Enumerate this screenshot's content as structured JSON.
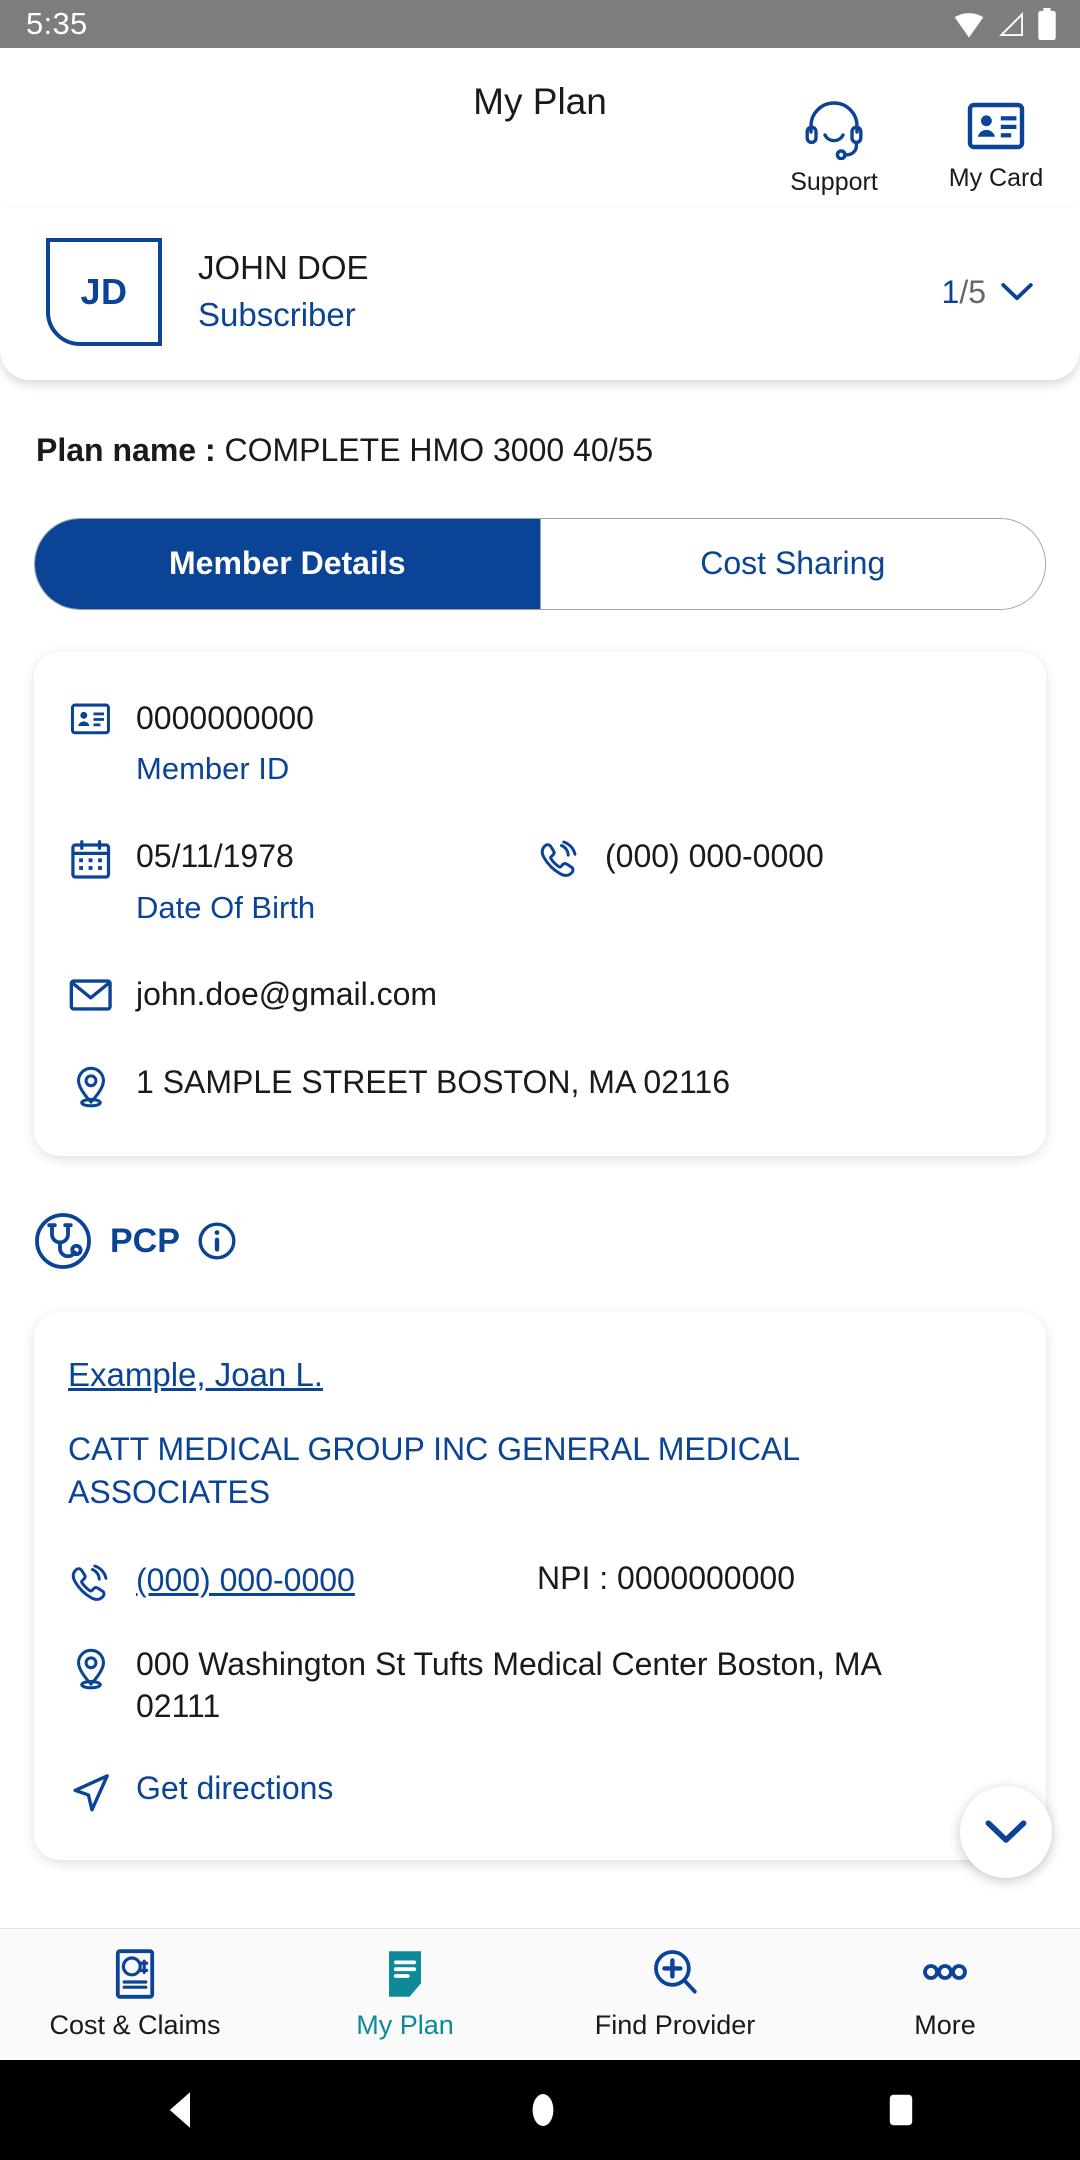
{
  "statusbar": {
    "time": "5:35"
  },
  "appbar": {
    "title": "My Plan",
    "actions": [
      {
        "label": "Support",
        "icon": "headset-icon"
      },
      {
        "label": "My Card",
        "icon": "id-card-icon"
      }
    ]
  },
  "member_header": {
    "initials": "JD",
    "name": "JOHN DOE",
    "role": "Subscriber",
    "pager_current": "1",
    "pager_rest": "/5"
  },
  "plan": {
    "label": "Plan name :",
    "value": "COMPLETE HMO 3000 40/55"
  },
  "tabs": [
    {
      "label": "Member Details",
      "active": true
    },
    {
      "label": "Cost Sharing",
      "active": false
    }
  ],
  "member_details": {
    "member_id": {
      "value": "0000000000",
      "label": "Member ID",
      "icon": "id-card-icon"
    },
    "dob": {
      "value": "05/11/1978",
      "label": "Date Of Birth",
      "icon": "calendar-icon"
    },
    "phone": {
      "value": "(000) 000-0000",
      "icon": "phone-icon"
    },
    "email": {
      "value": "john.doe@gmail.com",
      "icon": "mail-icon"
    },
    "address": {
      "value": "1 SAMPLE STREET BOSTON, MA 02116",
      "icon": "location-pin-icon"
    }
  },
  "pcp_section": {
    "title": "PCP",
    "icon": "stethoscope-icon",
    "info_icon": "info-icon"
  },
  "pcp": {
    "provider_name": "Example, Joan L.",
    "organization": "CATT MEDICAL GROUP INC GENERAL MEDICAL ASSOCIATES",
    "phone": "(000) 000-0000",
    "npi_label": "NPI :",
    "npi_value": "0000000000",
    "address": "000 Washington St Tufts Medical Center Boston, MA 02111",
    "directions_label": "Get directions",
    "expand_icon": "chevron-down-icon"
  },
  "bottom_nav": [
    {
      "label": "Cost & Claims",
      "icon": "receipt-dollar-icon",
      "active": false
    },
    {
      "label": "My Plan",
      "icon": "document-icon",
      "active": true
    },
    {
      "label": "Find Provider",
      "icon": "search-plus-icon",
      "active": false
    },
    {
      "label": "More",
      "icon": "ellipsis-icon",
      "active": false
    }
  ],
  "android_nav": [
    {
      "icon": "back-icon"
    },
    {
      "icon": "home-icon"
    },
    {
      "icon": "recents-icon"
    }
  ],
  "colors": {
    "primary": "#0b4496",
    "accent_teal": "#0c8a9a",
    "statusbar": "#7d7d7d"
  }
}
